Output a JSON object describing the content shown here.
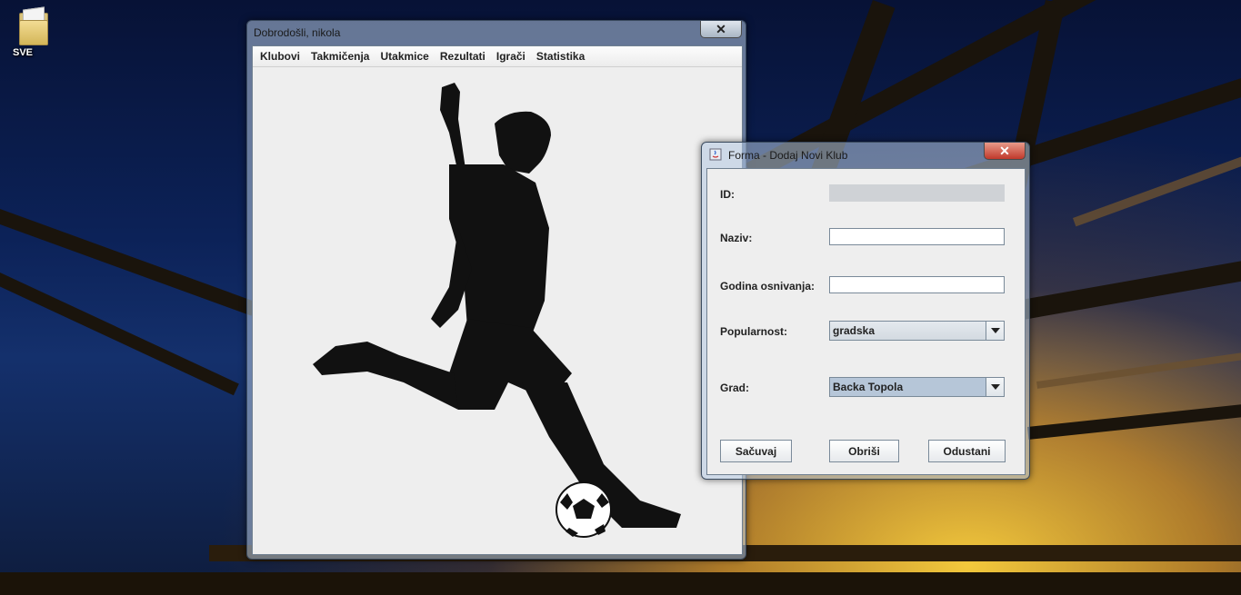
{
  "desktop": {
    "icons": [
      {
        "label": "SVE",
        "icon": "folder-icon"
      }
    ]
  },
  "main_window": {
    "title": "Dobrodošli, nikola",
    "close_glyph": "✕",
    "menu": [
      "Klubovi",
      "Takmičenja",
      "Utakmice",
      "Rezultati",
      "Igrači",
      "Statistika"
    ],
    "image": "football-player-silhouette"
  },
  "dialog": {
    "title": "Forma - Dodaj Novi Klub",
    "icon": "java-icon",
    "close_glyph": "✕",
    "fields": {
      "id": {
        "label": "ID:",
        "value": ""
      },
      "naziv": {
        "label": "Naziv:",
        "value": ""
      },
      "godina": {
        "label": "Godina osnivanja:",
        "value": ""
      },
      "popularnost": {
        "label": "Popularnost:",
        "value": "gradska"
      },
      "grad": {
        "label": "Grad:",
        "value": "Backa Topola"
      }
    },
    "buttons": {
      "save": "Sačuvaj",
      "delete": "Obriši",
      "cancel": "Odustani"
    }
  }
}
